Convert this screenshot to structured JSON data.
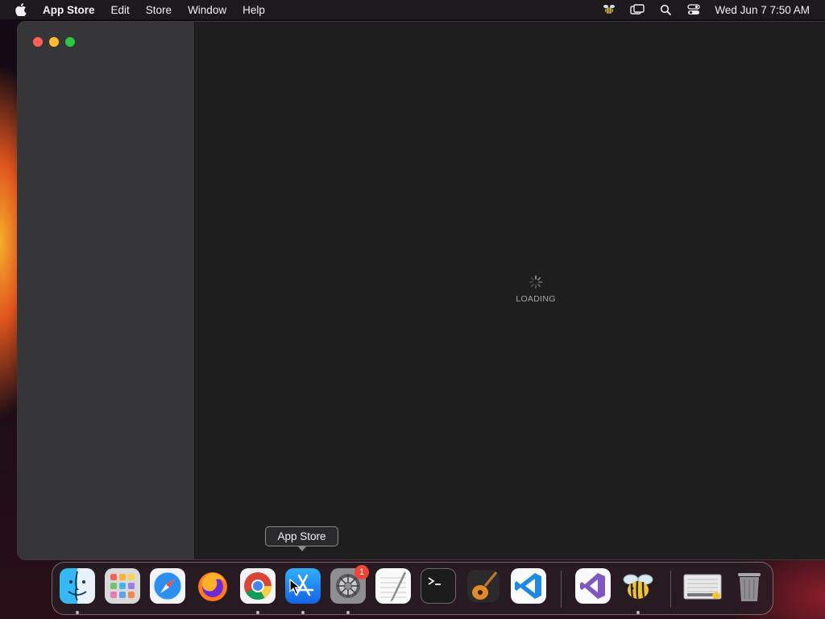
{
  "menubar": {
    "app_name": "App Store",
    "menus": [
      "Edit",
      "Store",
      "Window",
      "Help"
    ],
    "clock": "Wed Jun 7  7:50 AM",
    "status_icons": [
      "bee-menu-icon",
      "screen-mirroring-icon",
      "spotlight-search-icon",
      "control-center-icon"
    ]
  },
  "window": {
    "loading_text": "LOADING"
  },
  "tooltip": {
    "text": "App Store"
  },
  "dock": {
    "items": [
      {
        "name": "Finder",
        "icon": "finder-icon",
        "running": true
      },
      {
        "name": "Launchpad",
        "icon": "launchpad-icon",
        "running": false
      },
      {
        "name": "Safari",
        "icon": "safari-icon",
        "running": false
      },
      {
        "name": "Firefox",
        "icon": "firefox-icon",
        "running": false
      },
      {
        "name": "Google Chrome",
        "icon": "chrome-icon",
        "running": true
      },
      {
        "name": "App Store",
        "icon": "app-store-icon",
        "running": true
      },
      {
        "name": "System Settings",
        "icon": "system-settings-icon",
        "running": true,
        "badge": "1"
      },
      {
        "name": "TextEdit",
        "icon": "textedit-icon",
        "running": false
      },
      {
        "name": "Terminal",
        "icon": "terminal-icon",
        "running": false
      },
      {
        "name": "GarageBand",
        "icon": "garageband-icon",
        "running": false
      },
      {
        "name": "Visual Studio Code",
        "icon": "vscode-icon",
        "running": false
      },
      {
        "name": "Visual Studio",
        "icon": "visual-studio-icon",
        "running": false
      },
      {
        "name": "Bee app",
        "icon": "bee-icon",
        "running": true
      },
      {
        "name": "Downloads",
        "icon": "downloads-stack-icon",
        "running": false
      },
      {
        "name": "Trash",
        "icon": "trash-icon",
        "running": false
      }
    ]
  },
  "colors": {
    "window_bg": "#1e1e1e",
    "sidebar_bg": "#363537",
    "close": "#fe5f57",
    "minimize": "#febc2e",
    "maximize": "#28c840",
    "badge": "#f0463a"
  }
}
